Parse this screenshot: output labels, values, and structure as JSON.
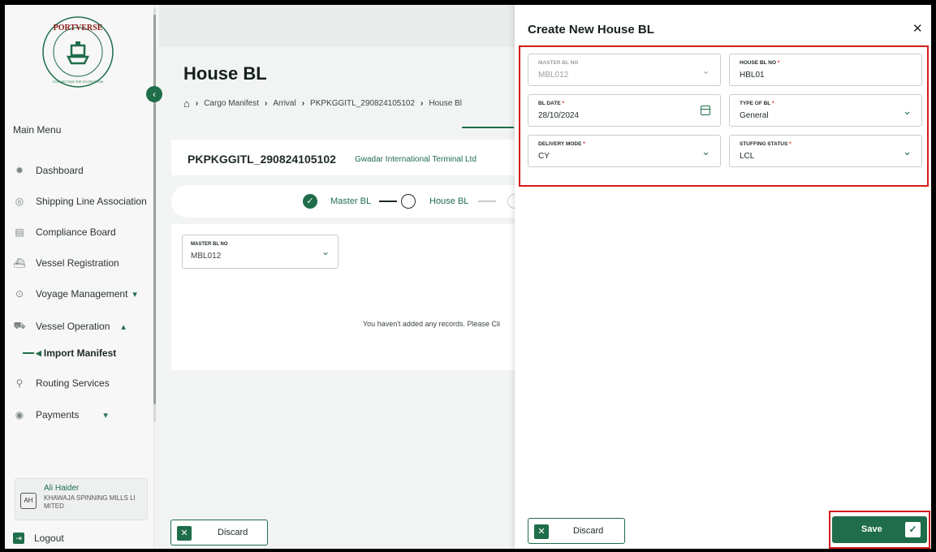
{
  "sidebar": {
    "logo_text": "PORTVERSE",
    "logo_tagline": "CONNECTING THE ECOSYSTEM",
    "main_menu_title": "Main Menu",
    "items": [
      {
        "label": "Dashboard",
        "icon": "dashboard-icon"
      },
      {
        "label": "Shipping Line Association",
        "icon": "shipping-line-icon"
      },
      {
        "label": "Compliance Board",
        "icon": "compliance-icon"
      },
      {
        "label": "Vessel Registration",
        "icon": "vessel-registration-icon"
      },
      {
        "label": "Voyage Management",
        "icon": "voyage-icon"
      },
      {
        "label": "Vessel Operation",
        "icon": "vessel-operation-icon"
      },
      {
        "label": "Routing Services",
        "icon": "routing-icon"
      },
      {
        "label": "Payments",
        "icon": "payments-icon"
      }
    ],
    "sub_item_active": "Import Manifest",
    "user": {
      "initials": "AH",
      "name": "Ali Haider",
      "company": "KHAWAJA SPINNING MILLS LI MITED"
    },
    "logout_label": "Logout"
  },
  "page": {
    "title": "House BL",
    "breadcrumb": [
      "Cargo Manifest",
      "Arrival",
      "PKPKGGITL_290824105102",
      "House Bl"
    ],
    "manifest_id": "PKPKGGITL_290824105102",
    "terminal_name": "Gwadar International Terminal Ltd",
    "steps": [
      "Master BL",
      "House BL"
    ],
    "master_bl_label": "MASTER BL NO",
    "master_bl_value": "MBL012",
    "empty_message": "You haven't added any records. Please Cli",
    "discard_label": "Discard"
  },
  "drawer": {
    "title": "Create New House BL",
    "fields": {
      "master_bl": {
        "label": "MASTER BL NO",
        "value": "MBL012"
      },
      "house_bl": {
        "label": "HOUSE BL NO",
        "value": "HBL01"
      },
      "bl_date": {
        "label": "BL DATE",
        "value": "28/10/2024"
      },
      "type_of_bl": {
        "label": "TYPE OF BL",
        "value": "General"
      },
      "delivery_mode": {
        "label": "DELIVERY MODE",
        "value": "CY"
      },
      "stuffing_status": {
        "label": "STUFFING STATUS",
        "value": "LCL"
      }
    },
    "required_mark": "*",
    "discard_label": "Discard",
    "save_label": "Save"
  },
  "colors": {
    "accent": "#1f6d4a",
    "highlight": "#d41c1c"
  }
}
